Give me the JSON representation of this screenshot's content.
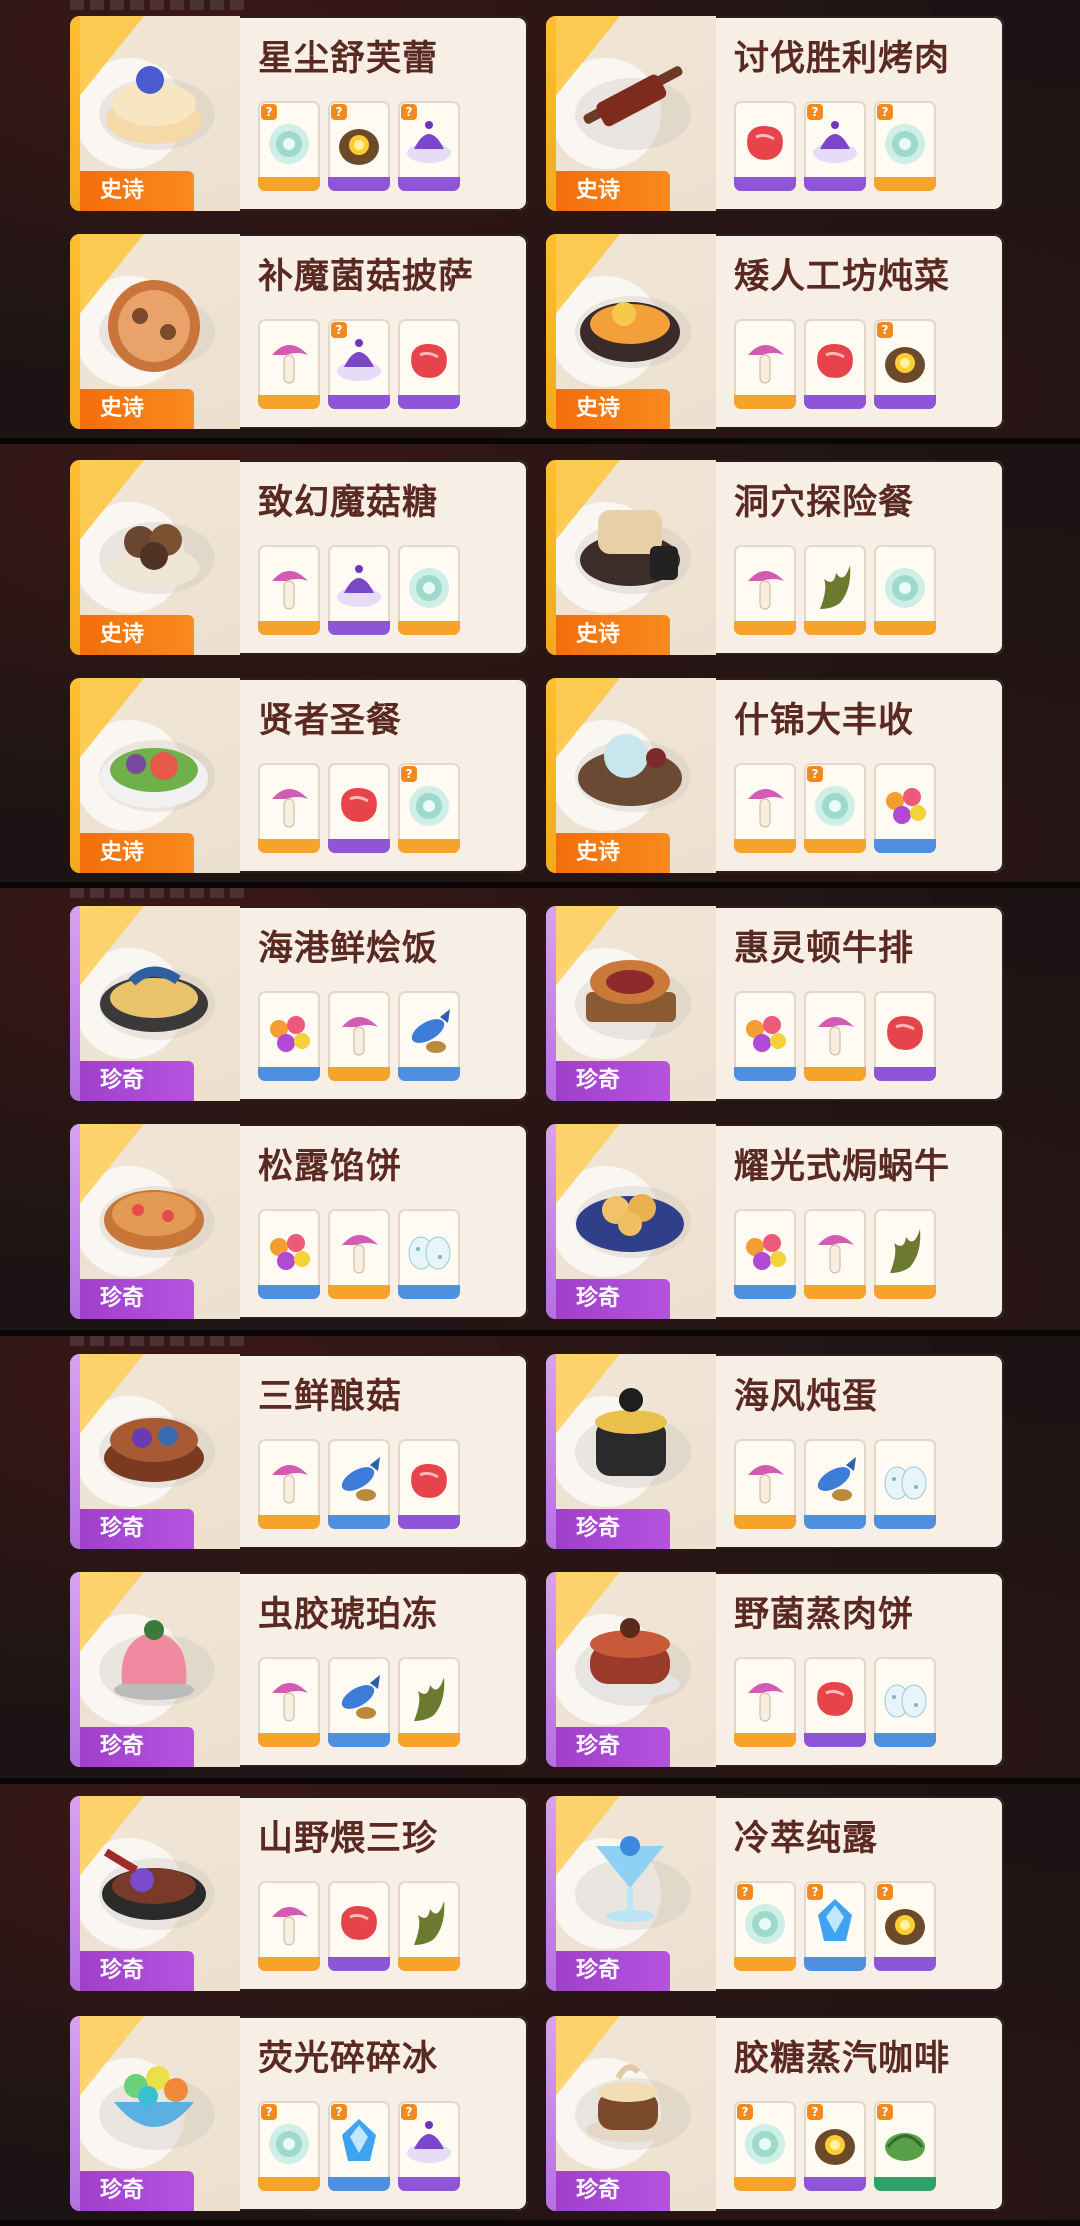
{
  "badge_labels": {
    "epic": "史诗",
    "rare": "珍奇"
  },
  "quest_mark": "?",
  "colors": {
    "epic_badge": "#f26c0a",
    "rare_badge": "#b553e0",
    "title_text": "#5a2a22",
    "card_bg": "#f7eee6",
    "page_bg": "#070708"
  },
  "recipes": [
    {
      "name": "星尘舒芙蕾",
      "tier": "epic",
      "dish_icon": "souffle-icon",
      "ingredients": [
        {
          "icon": "cabbage-icon",
          "tier": "orange",
          "quest": true
        },
        {
          "icon": "glowing-ore-icon",
          "tier": "purple",
          "quest": true
        },
        {
          "icon": "purple-truffle-icon",
          "tier": "purple",
          "quest": true
        }
      ]
    },
    {
      "name": "讨伐胜利烤肉",
      "tier": "epic",
      "dish_icon": "skewer-icon",
      "ingredients": [
        {
          "icon": "steak-icon",
          "tier": "purple",
          "quest": false
        },
        {
          "icon": "purple-truffle-icon",
          "tier": "purple",
          "quest": true
        },
        {
          "icon": "cabbage-icon",
          "tier": "orange",
          "quest": true
        }
      ]
    },
    {
      "name": "补魔菌菇披萨",
      "tier": "epic",
      "dish_icon": "pizza-icon",
      "ingredients": [
        {
          "icon": "mushroom-icon",
          "tier": "orange",
          "quest": false
        },
        {
          "icon": "purple-truffle-icon",
          "tier": "purple",
          "quest": true
        },
        {
          "icon": "steak-icon",
          "tier": "purple",
          "quest": false
        }
      ]
    },
    {
      "name": "矮人工坊炖菜",
      "tier": "epic",
      "dish_icon": "stew-icon",
      "ingredients": [
        {
          "icon": "mushroom-icon",
          "tier": "orange",
          "quest": false
        },
        {
          "icon": "steak-icon",
          "tier": "purple",
          "quest": false
        },
        {
          "icon": "glowing-ore-icon",
          "tier": "purple",
          "quest": true
        }
      ]
    },
    {
      "name": "致幻魔菇糖",
      "tier": "epic",
      "dish_icon": "mushroom-candy-icon",
      "ingredients": [
        {
          "icon": "mushroom-icon",
          "tier": "orange",
          "quest": false
        },
        {
          "icon": "purple-truffle-icon",
          "tier": "purple",
          "quest": false
        },
        {
          "icon": "cabbage-icon",
          "tier": "orange",
          "quest": false
        }
      ]
    },
    {
      "name": "洞穴探险餐",
      "tier": "epic",
      "dish_icon": "toast-meal-icon",
      "ingredients": [
        {
          "icon": "mushroom-icon",
          "tier": "orange",
          "quest": false
        },
        {
          "icon": "seaweed-icon",
          "tier": "orange",
          "quest": false
        },
        {
          "icon": "cabbage-icon",
          "tier": "orange",
          "quest": false
        }
      ]
    },
    {
      "name": "贤者圣餐",
      "tier": "epic",
      "dish_icon": "salad-icon",
      "ingredients": [
        {
          "icon": "mushroom-icon",
          "tier": "orange",
          "quest": false
        },
        {
          "icon": "steak-icon",
          "tier": "purple",
          "quest": false
        },
        {
          "icon": "cabbage-icon",
          "tier": "orange",
          "quest": true
        }
      ]
    },
    {
      "name": "什锦大丰收",
      "tier": "epic",
      "dish_icon": "harvest-bowl-icon",
      "ingredients": [
        {
          "icon": "mushroom-icon",
          "tier": "orange",
          "quest": false
        },
        {
          "icon": "cabbage-icon",
          "tier": "orange",
          "quest": true
        },
        {
          "icon": "berries-icon",
          "tier": "blue",
          "quest": false
        }
      ]
    },
    {
      "name": "海港鲜烩饭",
      "tier": "rare",
      "dish_icon": "paella-icon",
      "ingredients": [
        {
          "icon": "berries-icon",
          "tier": "blue",
          "quest": false
        },
        {
          "icon": "mushroom-icon",
          "tier": "orange",
          "quest": false
        },
        {
          "icon": "fish-icon",
          "tier": "blue",
          "quest": false
        }
      ]
    },
    {
      "name": "惠灵顿牛排",
      "tier": "rare",
      "dish_icon": "wellington-icon",
      "ingredients": [
        {
          "icon": "berries-icon",
          "tier": "blue",
          "quest": false
        },
        {
          "icon": "mushroom-icon",
          "tier": "orange",
          "quest": false
        },
        {
          "icon": "steak-icon",
          "tier": "purple",
          "quest": false
        }
      ]
    },
    {
      "name": "松露馅饼",
      "tier": "rare",
      "dish_icon": "pie-icon",
      "ingredients": [
        {
          "icon": "berries-icon",
          "tier": "blue",
          "quest": false
        },
        {
          "icon": "mushroom-icon",
          "tier": "orange",
          "quest": false
        },
        {
          "icon": "eggs-icon",
          "tier": "blue",
          "quest": false
        }
      ]
    },
    {
      "name": "耀光式焗蜗牛",
      "tier": "rare",
      "dish_icon": "snail-plate-icon",
      "ingredients": [
        {
          "icon": "berries-icon",
          "tier": "blue",
          "quest": false
        },
        {
          "icon": "mushroom-icon",
          "tier": "orange",
          "quest": false
        },
        {
          "icon": "seaweed-icon",
          "tier": "orange",
          "quest": false
        }
      ]
    },
    {
      "name": "三鲜酿菇",
      "tier": "rare",
      "dish_icon": "stuffed-mushroom-icon",
      "ingredients": [
        {
          "icon": "mushroom-icon",
          "tier": "orange",
          "quest": false
        },
        {
          "icon": "fish-icon",
          "tier": "blue",
          "quest": false
        },
        {
          "icon": "steak-icon",
          "tier": "purple",
          "quest": false
        }
      ]
    },
    {
      "name": "海风炖蛋",
      "tier": "rare",
      "dish_icon": "pot-icon",
      "ingredients": [
        {
          "icon": "mushroom-icon",
          "tier": "orange",
          "quest": false
        },
        {
          "icon": "fish-icon",
          "tier": "blue",
          "quest": false
        },
        {
          "icon": "eggs-icon",
          "tier": "blue",
          "quest": false
        }
      ]
    },
    {
      "name": "虫胶琥珀冻",
      "tier": "rare",
      "dish_icon": "jelly-icon",
      "ingredients": [
        {
          "icon": "mushroom-icon",
          "tier": "orange",
          "quest": false
        },
        {
          "icon": "fish-icon",
          "tier": "blue",
          "quest": false
        },
        {
          "icon": "seaweed-icon",
          "tier": "orange",
          "quest": false
        }
      ]
    },
    {
      "name": "野菌蒸肉饼",
      "tier": "rare",
      "dish_icon": "meat-cake-icon",
      "ingredients": [
        {
          "icon": "mushroom-icon",
          "tier": "orange",
          "quest": false
        },
        {
          "icon": "steak-icon",
          "tier": "purple",
          "quest": false
        },
        {
          "icon": "eggs-icon",
          "tier": "blue",
          "quest": false
        }
      ]
    },
    {
      "name": "山野煨三珍",
      "tier": "rare",
      "dish_icon": "skillet-icon",
      "ingredients": [
        {
          "icon": "mushroom-icon",
          "tier": "orange",
          "quest": false
        },
        {
          "icon": "steak-icon",
          "tier": "purple",
          "quest": false
        },
        {
          "icon": "seaweed-icon",
          "tier": "orange",
          "quest": false
        }
      ]
    },
    {
      "name": "冷萃纯露",
      "tier": "rare",
      "dish_icon": "cocktail-icon",
      "ingredients": [
        {
          "icon": "cabbage-icon",
          "tier": "orange",
          "quest": true
        },
        {
          "icon": "crystal-icon",
          "tier": "blue",
          "quest": true
        },
        {
          "icon": "glowing-ore-icon",
          "tier": "purple",
          "quest": true
        }
      ]
    },
    {
      "name": "荧光碎碎冰",
      "tier": "rare",
      "dish_icon": "shaved-ice-icon",
      "ingredients": [
        {
          "icon": "cabbage-icon",
          "tier": "orange",
          "quest": true
        },
        {
          "icon": "crystal-icon",
          "tier": "blue",
          "quest": true
        },
        {
          "icon": "purple-truffle-icon",
          "tier": "purple",
          "quest": true
        }
      ]
    },
    {
      "name": "胶糖蒸汽咖啡",
      "tier": "rare",
      "dish_icon": "coffee-icon",
      "ingredients": [
        {
          "icon": "cabbage-icon",
          "tier": "orange",
          "quest": true
        },
        {
          "icon": "glowing-ore-icon",
          "tier": "purple",
          "quest": true
        },
        {
          "icon": "green-shell-icon",
          "tier": "green",
          "quest": true
        }
      ]
    }
  ]
}
